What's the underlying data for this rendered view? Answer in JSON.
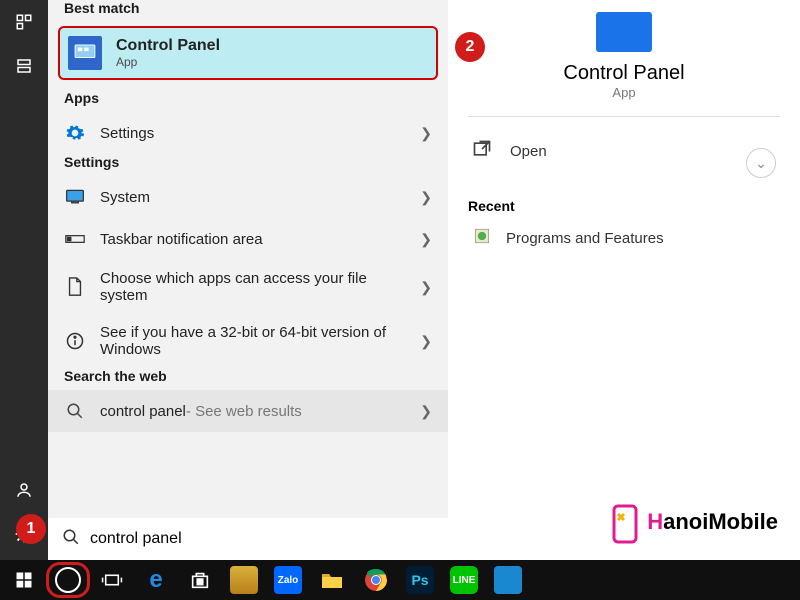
{
  "rail": {
    "items_top": [
      "grid-icon",
      "collection-icon"
    ],
    "items_bottom": [
      "person-icon",
      "gear-icon",
      "account-icon"
    ]
  },
  "sections": {
    "best_match_header": "Best match",
    "apps_header": "Apps",
    "settings_header": "Settings",
    "search_web_header": "Search the web"
  },
  "best_match": {
    "title": "Control Panel",
    "subtitle": "App"
  },
  "apps": [
    {
      "label": "Settings",
      "icon": "gear-blue"
    }
  ],
  "settings": [
    {
      "label": "System",
      "icon": "monitor"
    },
    {
      "label": "Taskbar notification area",
      "icon": "taskbar"
    },
    {
      "label": "Choose which apps can access your file system",
      "icon": "file"
    },
    {
      "label": "See if you have a 32-bit or 64-bit version of Windows",
      "icon": "info"
    }
  ],
  "web": {
    "query": "control panel",
    "suffix": " - See web results"
  },
  "search_input": {
    "value": "control panel"
  },
  "preview": {
    "title": "Control Panel",
    "subtitle": "App",
    "open_label": "Open",
    "recent_header": "Recent",
    "recent_items": [
      {
        "label": "Programs and Features"
      }
    ]
  },
  "taskbar": [
    "start",
    "cortana",
    "task-view",
    "edge",
    "store",
    "news",
    "zalo",
    "explorer",
    "chrome",
    "photoshop",
    "line",
    "onenote"
  ],
  "annotations": {
    "badge1": "1",
    "badge2": "2"
  },
  "watermark": {
    "brand_h": "H",
    "brand_rest": "anoiMobile"
  }
}
